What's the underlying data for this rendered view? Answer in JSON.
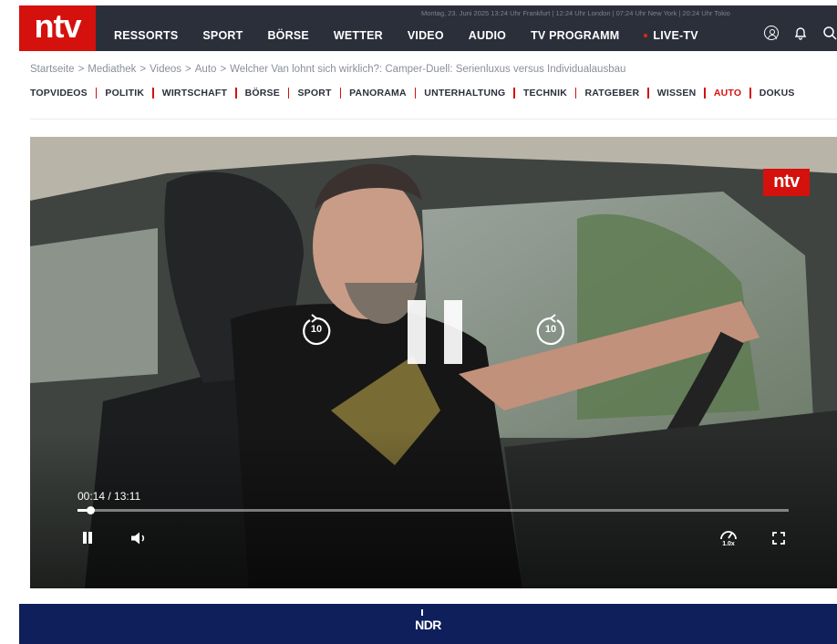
{
  "header": {
    "logo": "ntv",
    "dateline": "Montag, 23. Juni 2025 13:24 Uhr Frankfurt | 12:24 Uhr London | 07:24 Uhr New York | 20:24 Uhr Tokio",
    "nav": [
      "RESSORTS",
      "SPORT",
      "BÖRSE",
      "WETTER",
      "VIDEO",
      "AUDIO",
      "TV PROGRAMM"
    ],
    "live_label": "LIVE-TV",
    "icons": [
      "user-icon",
      "bell-icon",
      "search-icon"
    ],
    "accent_color": "#d4110c",
    "bar_color": "#2b2f3a"
  },
  "breadcrumb": [
    "Startseite",
    "Mediathek",
    "Videos",
    "Auto",
    "Welcher Van lohnt sich wirklich?: Camper-Duell: Serienluxus versus Individualausbau"
  ],
  "categories": [
    {
      "label": "TOPVIDEOS",
      "active": false
    },
    {
      "label": "POLITIK",
      "active": false
    },
    {
      "label": "WIRTSCHAFT",
      "active": false
    },
    {
      "label": "BÖRSE",
      "active": false
    },
    {
      "label": "SPORT",
      "active": false
    },
    {
      "label": "PANORAMA",
      "active": false
    },
    {
      "label": "UNTERHALTUNG",
      "active": false
    },
    {
      "label": "TECHNIK",
      "active": false
    },
    {
      "label": "RATGEBER",
      "active": false
    },
    {
      "label": "WISSEN",
      "active": false
    },
    {
      "label": "AUTO",
      "active": true
    },
    {
      "label": "DOKUS",
      "active": false
    }
  ],
  "player": {
    "watermark": "ntv",
    "skip_back": "10",
    "skip_forward": "10",
    "time_current": "00:14",
    "time_total": "13:11",
    "progress_fraction": 0.018,
    "speed_label": "1.0x",
    "state": "playing"
  },
  "footer_banner": {
    "logo": "NDR",
    "color": "#0e1f5b"
  }
}
